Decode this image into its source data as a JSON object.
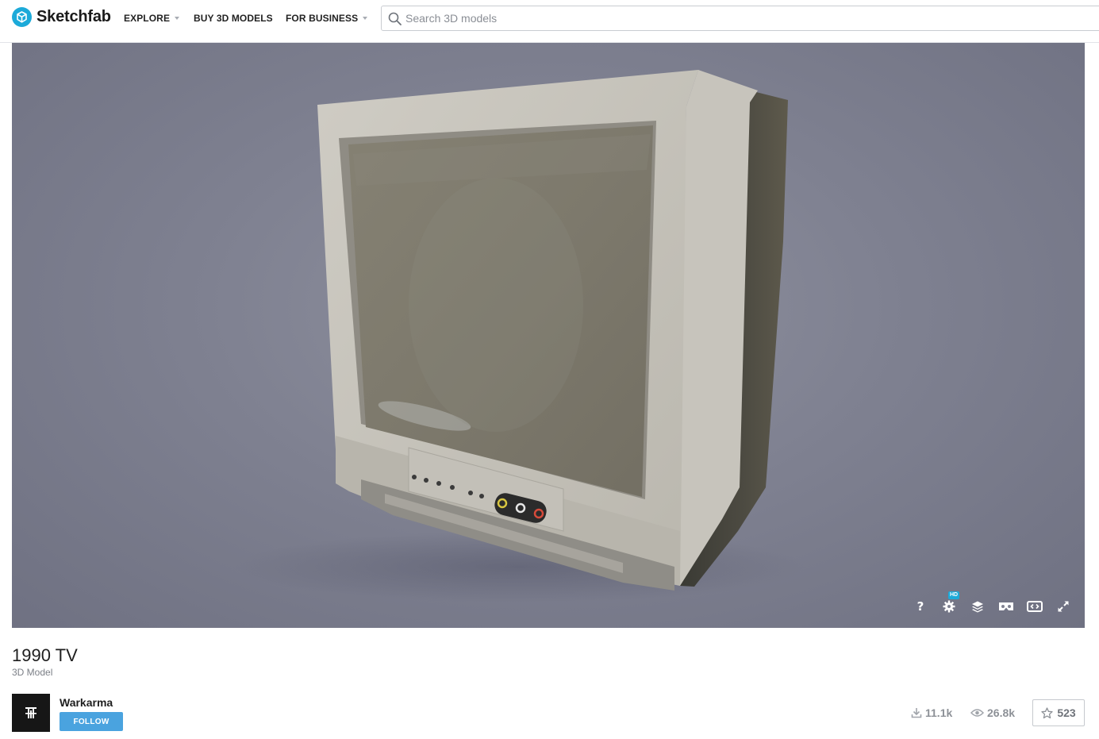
{
  "header": {
    "brand": "Sketchfab",
    "nav": [
      {
        "label": "EXPLORE",
        "has_dropdown": true
      },
      {
        "label": "BUY 3D MODELS",
        "has_dropdown": false
      },
      {
        "label": "FOR BUSINESS",
        "has_dropdown": true
      }
    ],
    "search": {
      "placeholder": "Search 3D models",
      "value": ""
    }
  },
  "viewer": {
    "subject": "CRT television",
    "controls": [
      {
        "name": "help-icon",
        "label": "?"
      },
      {
        "name": "settings-icon",
        "badge": "HD"
      },
      {
        "name": "layers-icon"
      },
      {
        "name": "vr-icon"
      },
      {
        "name": "embed-icon"
      },
      {
        "name": "fullscreen-icon"
      }
    ]
  },
  "model": {
    "title": "1990 TV",
    "type": "3D Model",
    "author": "Warkarma",
    "follow_label": "FOLLOW",
    "stats": {
      "downloads": "11.1k",
      "views": "26.8k",
      "likes": "523"
    }
  },
  "colors": {
    "brand": "#1caad9",
    "follow": "#4aa3df",
    "viewer_bg": "#808292"
  }
}
